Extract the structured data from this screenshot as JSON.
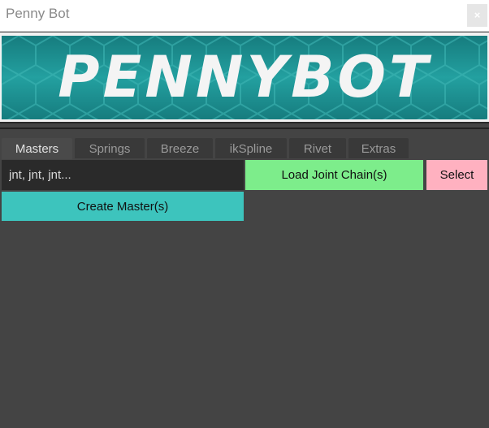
{
  "window": {
    "title": "Penny Bot",
    "close_glyph": "×"
  },
  "banner": {
    "text": "PENNYBOT",
    "color": "#1f8f8f"
  },
  "tabs": [
    {
      "label": "Masters",
      "active": true
    },
    {
      "label": "Springs",
      "active": false
    },
    {
      "label": "Breeze",
      "active": false
    },
    {
      "label": "ikSpline",
      "active": false
    },
    {
      "label": "Rivet",
      "active": false
    },
    {
      "label": "Extras",
      "active": false
    }
  ],
  "masters": {
    "joint_field_placeholder": "jnt, jnt, jnt...",
    "load_label": "Load Joint Chain(s)",
    "select_label": "Select",
    "create_label": "Create Master(s)"
  },
  "colors": {
    "load_button": "#7ded8b",
    "select_button": "#ffb1c0",
    "create_button": "#3dc4bd",
    "background": "#444444"
  }
}
